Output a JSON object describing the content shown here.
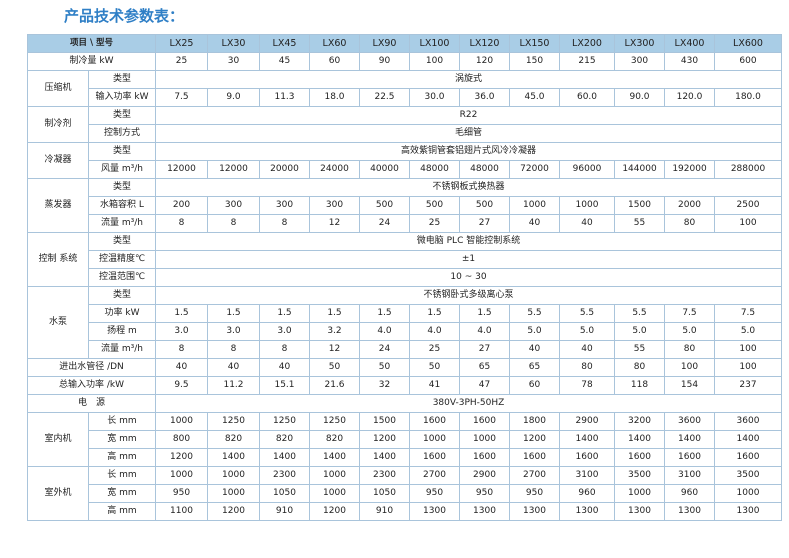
{
  "title": "产品技术参数表：",
  "corner": "项目 \\ 型号",
  "models": [
    "LX25",
    "LX30",
    "LX45",
    "LX60",
    "LX90",
    "LX100",
    "LX120",
    "LX150",
    "LX200",
    "LX300",
    "LX400",
    "LX600"
  ],
  "rows": [
    {
      "g": "制冷量 kW",
      "span": 2,
      "vals": [
        "25",
        "30",
        "45",
        "60",
        "90",
        "100",
        "120",
        "150",
        "215",
        "300",
        "430",
        "600"
      ]
    },
    {
      "g": "压缩机",
      "gs": 2,
      "s": "类型",
      "merged": "涡旋式"
    },
    {
      "s": "输入功率 kW",
      "vals": [
        "7.5",
        "9.0",
        "11.3",
        "18.0",
        "22.5",
        "30.0",
        "36.0",
        "45.0",
        "60.0",
        "90.0",
        "120.0",
        "180.0"
      ]
    },
    {
      "g": "制冷剂",
      "gs": 2,
      "s": "类型",
      "merged": "R22"
    },
    {
      "s": "控制方式",
      "merged": "毛细管"
    },
    {
      "g": "冷凝器",
      "gs": 2,
      "s": "类型",
      "merged": "高效紫铜管套铝翅片式风冷冷凝器"
    },
    {
      "s": "风量 m³/h",
      "vals": [
        "12000",
        "12000",
        "20000",
        "24000",
        "40000",
        "48000",
        "48000",
        "72000",
        "96000",
        "144000",
        "192000",
        "288000"
      ]
    },
    {
      "g": "蒸发器",
      "gs": 3,
      "s": "类型",
      "merged": "不锈钢板式换热器"
    },
    {
      "s": "水箱容积 L",
      "vals": [
        "200",
        "300",
        "300",
        "300",
        "500",
        "500",
        "500",
        "1000",
        "1000",
        "1500",
        "2000",
        "2500"
      ]
    },
    {
      "s": "流量 m³/h",
      "vals": [
        "8",
        "8",
        "8",
        "12",
        "24",
        "25",
        "27",
        "40",
        "40",
        "55",
        "80",
        "100"
      ]
    },
    {
      "g": "控制\n系统",
      "gs": 3,
      "s": "类型",
      "merged": "微电脑 PLC 智能控制系统"
    },
    {
      "s": "控温精度℃",
      "merged": "±1"
    },
    {
      "s": "控温范围℃",
      "merged": "10 ~ 30"
    },
    {
      "g": "水泵",
      "gs": 4,
      "s": "类型",
      "merged": "不锈钢卧式多级离心泵"
    },
    {
      "s": "功率 kW",
      "vals": [
        "1.5",
        "1.5",
        "1.5",
        "1.5",
        "1.5",
        "1.5",
        "1.5",
        "5.5",
        "5.5",
        "5.5",
        "7.5",
        "7.5"
      ]
    },
    {
      "s": "扬程 m",
      "vals": [
        "3.0",
        "3.0",
        "3.0",
        "3.2",
        "4.0",
        "4.0",
        "4.0",
        "5.0",
        "5.0",
        "5.0",
        "5.0",
        "5.0"
      ]
    },
    {
      "s": "流量 m³/h",
      "vals": [
        "8",
        "8",
        "8",
        "12",
        "24",
        "25",
        "27",
        "40",
        "40",
        "55",
        "80",
        "100"
      ]
    },
    {
      "g": "进出水管径 /DN",
      "span": 2,
      "vals": [
        "40",
        "40",
        "40",
        "50",
        "50",
        "50",
        "65",
        "65",
        "80",
        "80",
        "100",
        "100"
      ]
    },
    {
      "g": "总输入功率 /kW",
      "span": 2,
      "vals": [
        "9.5",
        "11.2",
        "15.1",
        "21.6",
        "32",
        "41",
        "47",
        "60",
        "78",
        "118",
        "154",
        "237"
      ]
    },
    {
      "g": "电　源",
      "span": 2,
      "merged": "380V-3PH-50HZ"
    },
    {
      "g": "室内机",
      "gs": 3,
      "s": "长 mm",
      "vals": [
        "1000",
        "1250",
        "1250",
        "1250",
        "1500",
        "1600",
        "1600",
        "1800",
        "2900",
        "3200",
        "3600",
        "3600"
      ]
    },
    {
      "s": "宽 mm",
      "vals": [
        "800",
        "820",
        "820",
        "820",
        "1200",
        "1000",
        "1000",
        "1200",
        "1400",
        "1400",
        "1400",
        "1400"
      ]
    },
    {
      "s": "高 mm",
      "vals": [
        "1200",
        "1400",
        "1400",
        "1400",
        "1400",
        "1600",
        "1600",
        "1600",
        "1600",
        "1600",
        "1600",
        "1600"
      ]
    },
    {
      "g": "室外机",
      "gs": 3,
      "s": "长 mm",
      "vals": [
        "1000",
        "1000",
        "2300",
        "1000",
        "2300",
        "2700",
        "2900",
        "2700",
        "3100",
        "3500",
        "3100",
        "3500"
      ]
    },
    {
      "s": "宽 mm",
      "vals": [
        "950",
        "1000",
        "1050",
        "1000",
        "1050",
        "950",
        "950",
        "950",
        "960",
        "1000",
        "960",
        "1000"
      ]
    },
    {
      "s": "高 mm",
      "vals": [
        "1100",
        "1200",
        "910",
        "1200",
        "910",
        "1300",
        "1300",
        "1300",
        "1300",
        "1300",
        "1300",
        "1300"
      ]
    }
  ]
}
